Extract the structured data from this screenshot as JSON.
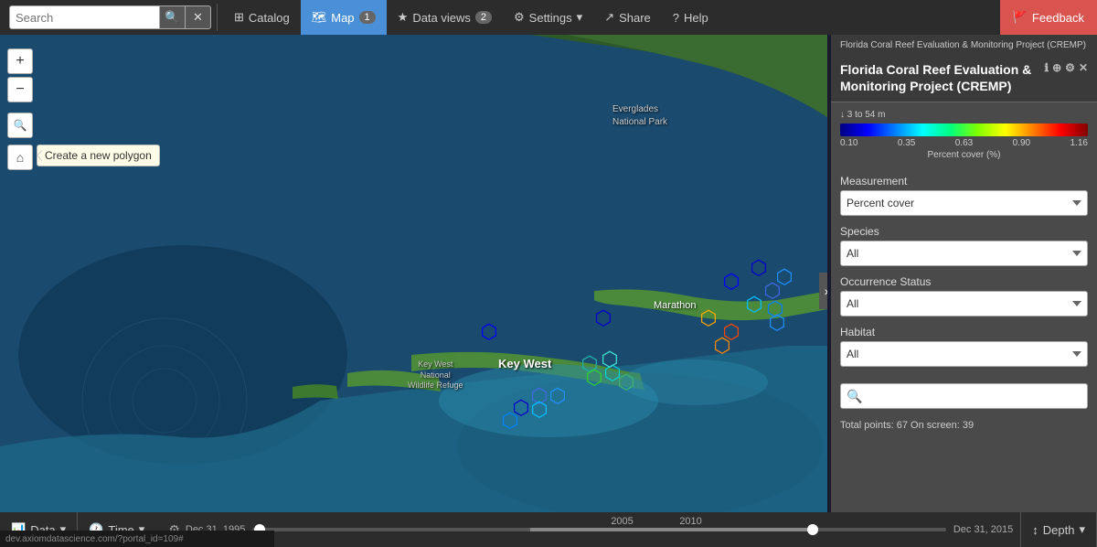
{
  "nav": {
    "search_placeholder": "Search",
    "catalog_label": "Catalog",
    "map_label": "Map",
    "map_count": "1",
    "dataviews_label": "Data views",
    "dataviews_count": "2",
    "settings_label": "Settings",
    "share_label": "Share",
    "help_label": "Help",
    "feedback_label": "Feedback"
  },
  "map_controls": {
    "zoom_in": "+",
    "zoom_out": "−",
    "zoom_fit": "⊕",
    "draw_polygon": "⬡",
    "tooltip_polygon": "Create a new polygon"
  },
  "map_labels": {
    "everglades": "Everglades\nNational Park",
    "marathon": "Marathon",
    "keywest": "Key West",
    "keywest_refuge": "Key West\nNational\nWildlife Refuge"
  },
  "panel": {
    "header_small": "Florida Coral Reef Evaluation & Monitoring Project (CREMP)",
    "title": "Florida Coral Reef Evaluation & Monitoring Project (CREMP)",
    "colorbar": {
      "depth_label": "↓ 3 to 54 m",
      "tick0": "0.10",
      "tick1": "0.35",
      "tick2": "0.63",
      "tick3": "0.90",
      "tick4": "1.16",
      "axis_label": "Percent cover (%)"
    },
    "measurement_label": "Measurement",
    "measurement_value": "Percent cover",
    "species_label": "Species",
    "species_value": "All",
    "occurrence_label": "Occurrence Status",
    "occurrence_value": "All",
    "habitat_label": "Habitat",
    "habitat_value": "All",
    "search_placeholder": "",
    "stats": "Total points: 67  On screen: 39"
  },
  "bottom": {
    "data_label": "Data",
    "time_label": "Time",
    "depth_label": "Depth",
    "timeline_start": "Dec 31, 1995",
    "timeline_mid1": "2005",
    "timeline_mid2": "2010",
    "timeline_end": "Dec 31, 2015"
  },
  "url": "dev.axiomdatascience.com/?portal_id=109#"
}
